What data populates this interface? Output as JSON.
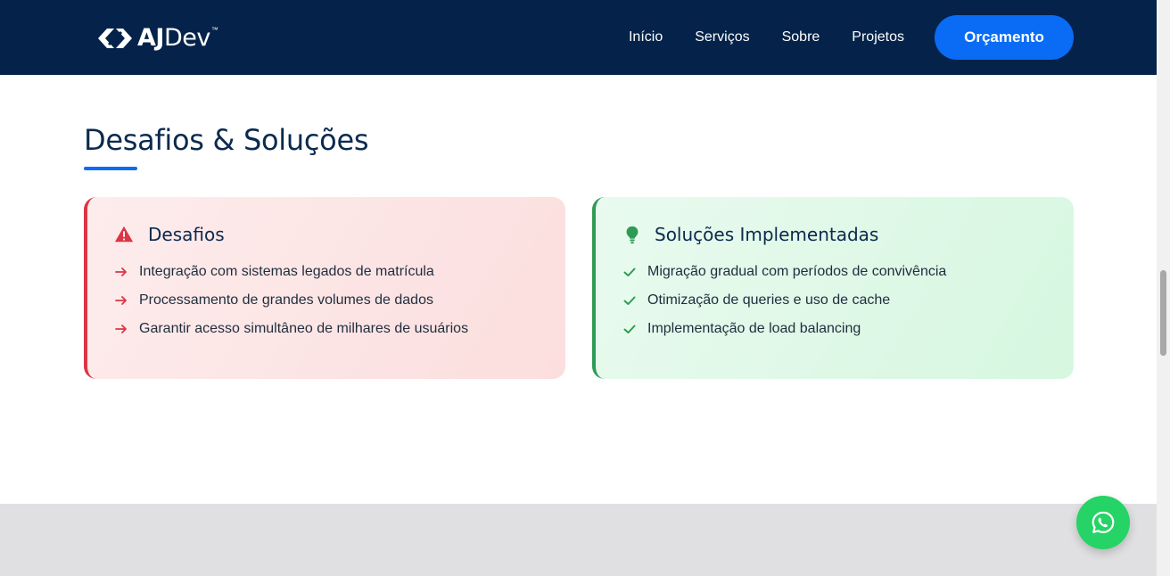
{
  "header": {
    "logo": {
      "bold": "AJ",
      "light": "Dev",
      "tm": "™"
    },
    "nav": [
      {
        "label": "Início"
      },
      {
        "label": "Serviços"
      },
      {
        "label": "Sobre"
      },
      {
        "label": "Projetos"
      }
    ],
    "cta_label": "Orçamento"
  },
  "section": {
    "title": "Desafios & Soluções"
  },
  "challenges": {
    "title": "Desafios",
    "icon": "warning-triangle-icon",
    "accent": "#dc3545",
    "items": [
      "Integração com sistemas legados de matrícula",
      "Processamento de grandes volumes de dados",
      "Garantir acesso simultâneo de milhares de usuários"
    ]
  },
  "solutions": {
    "title": "Soluções Implementadas",
    "icon": "lightbulb-icon",
    "accent": "#2e9b55",
    "items": [
      "Migração gradual com períodos de convivência",
      "Otimização de queries e uso de cache",
      "Implementação de load balancing"
    ]
  },
  "colors": {
    "header_bg": "#05234a",
    "brand_blue": "#0a6cf5",
    "whatsapp_green": "#25d366"
  }
}
